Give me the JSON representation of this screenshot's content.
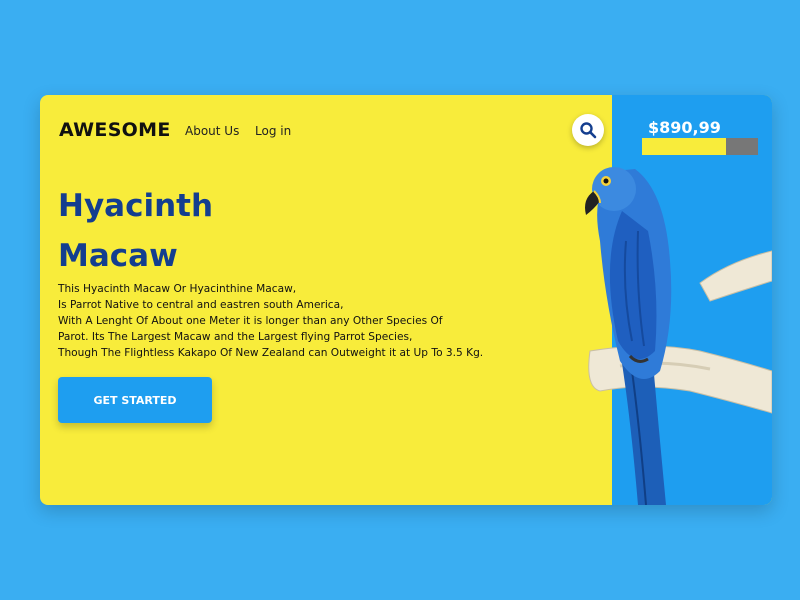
{
  "header": {
    "logo": "AWESOME",
    "nav": {
      "about": "About Us",
      "login": "Log in"
    }
  },
  "hero": {
    "title_line1": "Hyacinth",
    "title_line2": "Macaw",
    "description": [
      "This Hyacinth Macaw Or Hyacinthine Macaw,",
      "Is Parrot Native to central and eastren south America,",
      "With A Lenght Of About one Meter it is longer than any Other Species Of",
      "Parot. Its The Largest Macaw and the Largest flying Parrot Species,",
      "Though The Flightless Kakapo Of New Zealand can Outweight it at Up To 3.5 Kg."
    ],
    "cta_label": "GET STARTED"
  },
  "sidebar": {
    "price": "$890,99",
    "progress_fraction": 0.72,
    "search_icon": "search-icon"
  },
  "colors": {
    "background": "#3aaef2",
    "card_yellow": "#f8ec3b",
    "panel_blue": "#1e9ef0",
    "title_blue": "#143e8f",
    "progress_track": "#777777"
  }
}
